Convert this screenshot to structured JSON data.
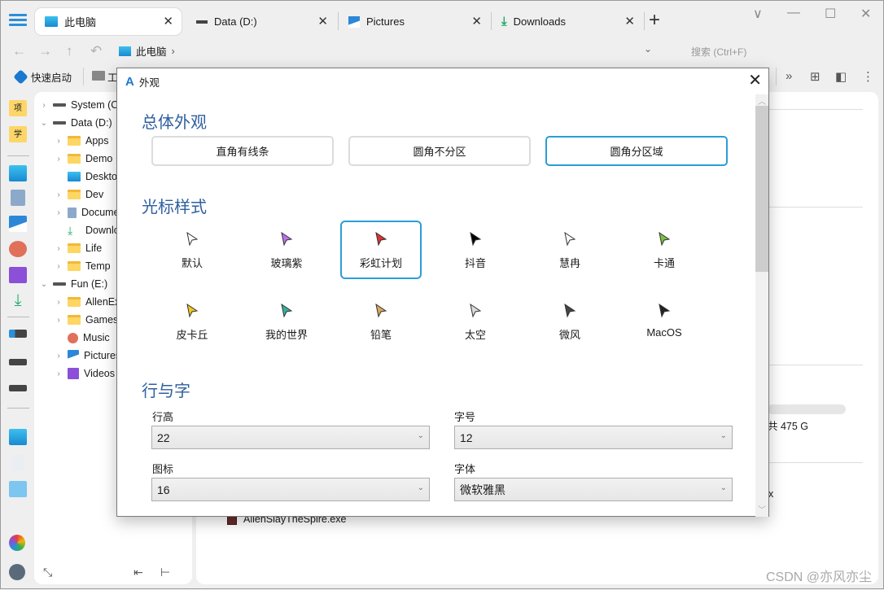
{
  "window": {
    "tabs": [
      {
        "label": "此电脑",
        "icon": "monitor-icon",
        "active": true
      },
      {
        "label": "Data (D:)",
        "icon": "drive-icon",
        "active": false
      },
      {
        "label": "Pictures",
        "icon": "pictures-icon",
        "active": false
      },
      {
        "label": "Downloads",
        "icon": "download-icon",
        "active": false
      }
    ],
    "new_tab": "+",
    "close_glyph": "✕",
    "controls": {
      "dropdown": "∨",
      "minimize": "—",
      "maximize": "☐",
      "close": "✕"
    }
  },
  "address": {
    "back": "←",
    "forward": "→",
    "up": "↑",
    "undo": "↶",
    "breadcrumb": "此电脑",
    "crumb_sep": "›",
    "dropdown": "⌄",
    "search_placeholder": "搜索 (Ctrl+F)"
  },
  "toolbar": {
    "quick_start": "快速启动",
    "folder_label": "工",
    "right_icons": [
      "»",
      "⊞",
      "◧",
      "⋮"
    ]
  },
  "rail": {
    "items": [
      "项",
      "学"
    ]
  },
  "tree": {
    "nodes": [
      {
        "label": "System (C:)",
        "caret": "›",
        "type": "drive",
        "level": 0
      },
      {
        "label": "Data (D:)",
        "caret": "⌄",
        "type": "drive",
        "level": 0
      },
      {
        "label": "Apps",
        "caret": "›",
        "type": "folder",
        "level": 1
      },
      {
        "label": "Demo",
        "caret": "›",
        "type": "folder",
        "level": 1
      },
      {
        "label": "Desktop",
        "caret": "",
        "type": "desktop",
        "level": 1
      },
      {
        "label": "Dev",
        "caret": "›",
        "type": "folder",
        "level": 1
      },
      {
        "label": "Documents",
        "caret": "›",
        "type": "doc",
        "level": 1
      },
      {
        "label": "Downloads",
        "caret": "",
        "type": "download",
        "level": 1
      },
      {
        "label": "Life",
        "caret": "›",
        "type": "folder",
        "level": 1
      },
      {
        "label": "Temp",
        "caret": "›",
        "type": "folder",
        "level": 1
      },
      {
        "label": "Fun (E:)",
        "caret": "⌄",
        "type": "drive",
        "level": 0
      },
      {
        "label": "AllenEx",
        "caret": "›",
        "type": "folder",
        "level": 1
      },
      {
        "label": "Games",
        "caret": "›",
        "type": "folder",
        "level": 1
      },
      {
        "label": "Music",
        "caret": "",
        "type": "music",
        "level": 1
      },
      {
        "label": "Pictures",
        "caret": "›",
        "type": "pictures",
        "level": 1
      },
      {
        "label": "Videos",
        "caret": "›",
        "type": "videos",
        "level": 1
      }
    ],
    "bottom_icons": [
      "⤡",
      "⇤",
      "⊢"
    ]
  },
  "content": {
    "capacity_text": "共 475 G",
    "partial_text": "x",
    "file": "AllenSlayTheSpire.exe",
    "watermark": "CSDN @亦风亦尘"
  },
  "dialog": {
    "title": "外观",
    "close": "✕",
    "sections": {
      "appearance": "总体外观",
      "cursor": "光标样式",
      "text": "行与字"
    },
    "appearance_options": [
      {
        "label": "直角有线条",
        "selected": false
      },
      {
        "label": "圆角不分区",
        "selected": false
      },
      {
        "label": "圆角分区域",
        "selected": true
      }
    ],
    "cursors": [
      {
        "label": "默认",
        "selected": false,
        "color": "#ffffff"
      },
      {
        "label": "玻璃紫",
        "selected": false,
        "color": "#c070f0"
      },
      {
        "label": "彩虹计划",
        "selected": true,
        "color": "#e23030"
      },
      {
        "label": "抖音",
        "selected": false,
        "color": "#000000"
      },
      {
        "label": "慧冉",
        "selected": false,
        "color": "#ffffff"
      },
      {
        "label": "卡通",
        "selected": false,
        "color": "#7cc040"
      },
      {
        "label": "皮卡丘",
        "selected": false,
        "color": "#f2c81a"
      },
      {
        "label": "我的世界",
        "selected": false,
        "color": "#35b0a0"
      },
      {
        "label": "铅笔",
        "selected": false,
        "color": "#d9a860"
      },
      {
        "label": "太空",
        "selected": false,
        "color": "#dddddd"
      },
      {
        "label": "微风",
        "selected": false,
        "color": "#444444"
      },
      {
        "label": "MacOS",
        "selected": false,
        "color": "#222222"
      }
    ],
    "fields": {
      "line_height": {
        "label": "行高",
        "value": "22"
      },
      "font_size": {
        "label": "字号",
        "value": "12"
      },
      "icon_size": {
        "label": "图标",
        "value": "16"
      },
      "font_family": {
        "label": "字体",
        "value": "微软雅黑"
      }
    },
    "chevron": "⌄"
  },
  "colors": {
    "accent": "#2b9ed6",
    "section_title": "#2f5f9e"
  }
}
